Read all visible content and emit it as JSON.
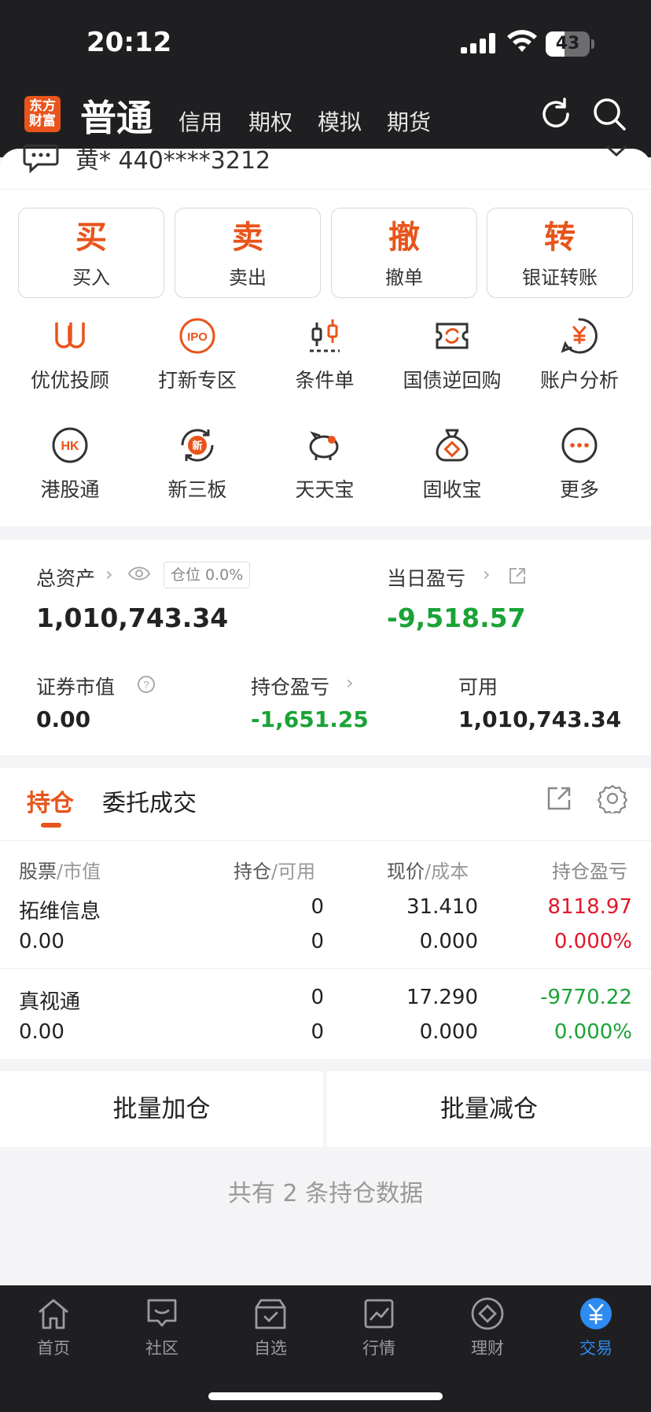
{
  "status": {
    "time": "20:12",
    "battery": "43",
    "battery_level": 0.43
  },
  "header": {
    "logo": "东方\n财富",
    "tabs": [
      "普通",
      "信用",
      "期权",
      "模拟",
      "期货"
    ]
  },
  "account": {
    "text": "黄* 440****3212"
  },
  "actions": [
    {
      "char": "买",
      "label": "买入"
    },
    {
      "char": "卖",
      "label": "卖出"
    },
    {
      "char": "撤",
      "label": "撤单"
    },
    {
      "char": "转",
      "label": "银证转账"
    }
  ],
  "grid": [
    {
      "label": "优优投顾",
      "icon": "uu-icon"
    },
    {
      "label": "打新专区",
      "icon": "ipo-icon"
    },
    {
      "label": "条件单",
      "icon": "candlestick-icon"
    },
    {
      "label": "国债逆回购",
      "icon": "repo-icon"
    },
    {
      "label": "账户分析",
      "icon": "yen-chat-icon"
    },
    {
      "label": "港股通",
      "icon": "hk-icon"
    },
    {
      "label": "新三板",
      "icon": "new-board-icon"
    },
    {
      "label": "天天宝",
      "icon": "piggy-icon"
    },
    {
      "label": "固收宝",
      "icon": "moneybag-icon"
    },
    {
      "label": "更多",
      "icon": "more-icon"
    }
  ],
  "assets": {
    "total_label": "总资产",
    "position_badge": "仓位  0.0%",
    "total_value": "1,010,743.34",
    "daily_label": "当日盈亏",
    "daily_value": "-9,518.57",
    "market_label": "证券市值",
    "market_value": "0.00",
    "holding_pl_label": "持仓盈亏",
    "holding_pl_value": "-1,651.25",
    "available_label": "可用",
    "available_value": "1,010,743.34"
  },
  "positions": {
    "tabs": [
      "持仓",
      "委托成交"
    ],
    "columns": [
      {
        "main": "股票",
        "sub": "/市值"
      },
      {
        "main": "持仓",
        "sub": "/可用"
      },
      {
        "main": "现价",
        "sub": "/成本"
      },
      {
        "main": "持仓盈亏",
        "sub": ""
      }
    ],
    "rows": [
      {
        "name": "拓维信息",
        "value": "0.00",
        "hold": "0",
        "avail": "0",
        "price": "31.410",
        "cost": "0.000",
        "pl": "8118.97",
        "pl_pct": "0.000%",
        "trend": "up"
      },
      {
        "name": "真视通",
        "value": "0.00",
        "hold": "0",
        "avail": "0",
        "price": "17.290",
        "cost": "0.000",
        "pl": "-9770.22",
        "pl_pct": "0.000%",
        "trend": "down"
      }
    ]
  },
  "batch": {
    "add": "批量加仓",
    "reduce": "批量减仓"
  },
  "footer_note": "共有 2 条持仓数据",
  "nav": [
    {
      "label": "首页",
      "icon": "home-icon"
    },
    {
      "label": "社区",
      "icon": "community-icon"
    },
    {
      "label": "自选",
      "icon": "watchlist-icon"
    },
    {
      "label": "行情",
      "icon": "market-icon"
    },
    {
      "label": "理财",
      "icon": "wealth-icon"
    },
    {
      "label": "交易",
      "icon": "trade-icon"
    }
  ],
  "colors": {
    "accent": "#e8541b",
    "up": "#e0182b",
    "down": "#1aa336",
    "nav_active": "#2e8bf0"
  }
}
